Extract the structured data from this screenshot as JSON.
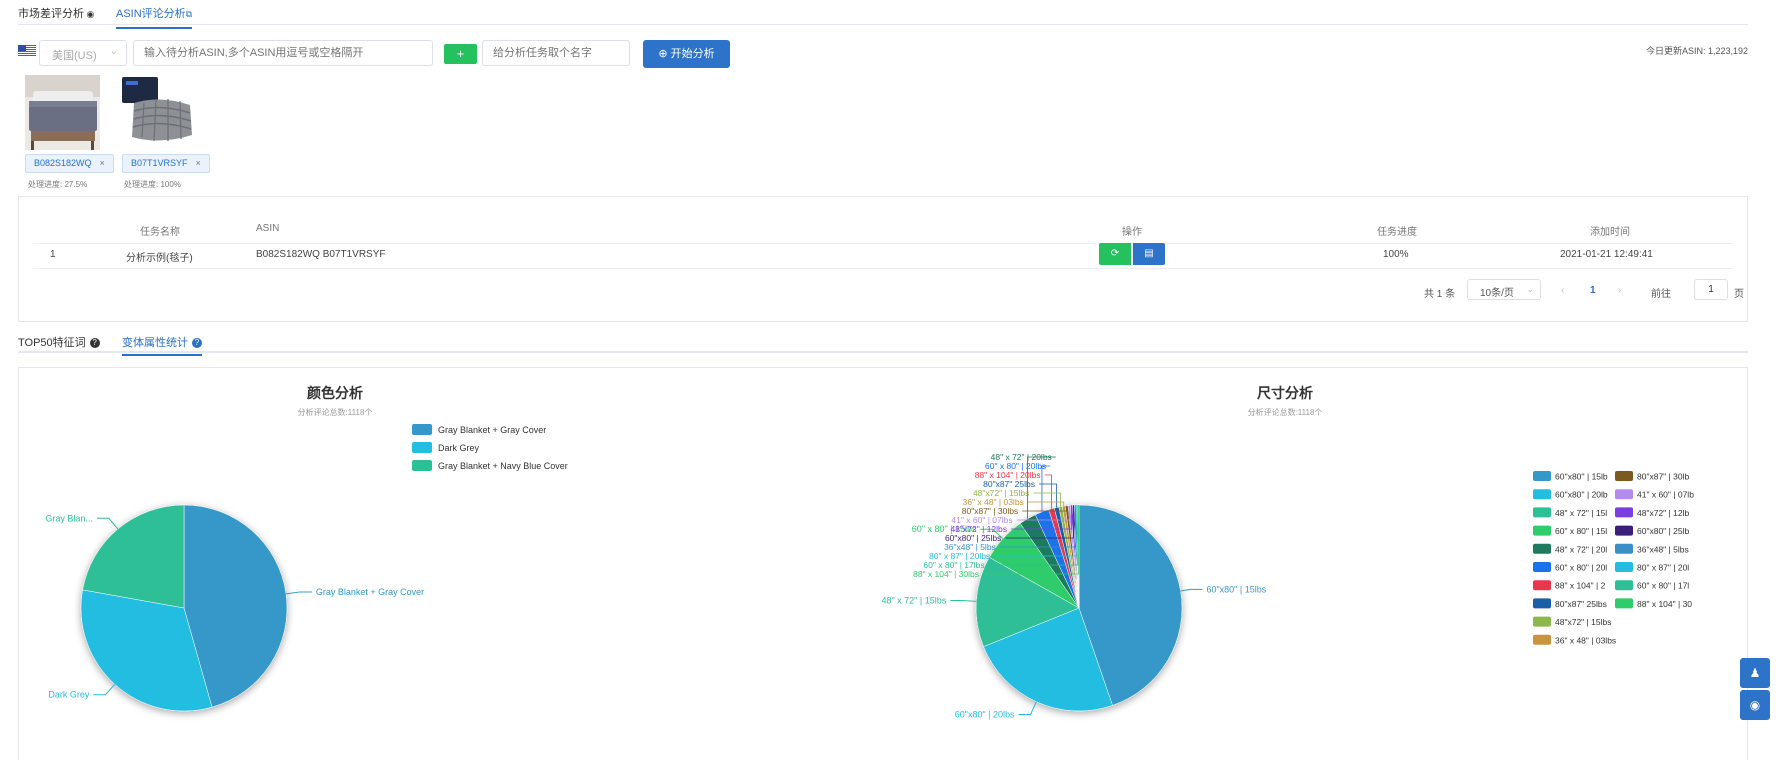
{
  "nav": {
    "tab_market": "市场差评分析",
    "tab_asin": "ASIN评论分析"
  },
  "toolbar": {
    "marketplace": "美国(US)",
    "asin_placeholder": "输入待分析ASIN,多个ASIN用逗号或空格隔开",
    "plus_label": "+",
    "name_placeholder": "给分析任务取个名字",
    "start_label": "开始分析",
    "today_updated": "今日更新ASIN: 1,223,192"
  },
  "asins": [
    {
      "code": "B082S182WQ",
      "progress": "处理进度:   27.5%"
    },
    {
      "code": "B07T1VRSYF",
      "progress": "处理进度:   100%"
    }
  ],
  "table": {
    "headers": {
      "name": "任务名称",
      "asin": "ASIN",
      "op": "操作",
      "progress": "任务进度",
      "time": "添加时间"
    },
    "rows": [
      {
        "index": "1",
        "name": "分析示例(毯子)",
        "asin": "B082S182WQ B07T1VRSYF",
        "progress": "100%",
        "time": "2021-01-21 12:49:41"
      }
    ]
  },
  "pagination": {
    "total": "共 1 条",
    "page_size": "10条/页",
    "current": "1",
    "goto_label": "前往",
    "goto_value": "1",
    "page_unit": "页"
  },
  "subtabs": {
    "top50": "TOP50特征词",
    "variant": "变体属性统计"
  },
  "colors": {
    "accent": "#2b6fc7",
    "green": "#25c15f"
  },
  "chart_data": [
    {
      "type": "pie",
      "title": "颜色分析",
      "subtitle": "分析评论总数:1118个",
      "legend_position": "right",
      "slices": [
        {
          "label": "Gray Blanket + Gray Cover",
          "value": 510,
          "color": "#3498c8",
          "callout": "Gray Blanket + Gray Cover"
        },
        {
          "label": "Dark Grey",
          "value": 360,
          "color": "#23bde0",
          "callout": "Dark Grey"
        },
        {
          "label": "Gray Blanket + Navy Blue Cover",
          "value": 248,
          "color": "#2dbf96",
          "callout": "Gray Blan..."
        }
      ]
    },
    {
      "type": "pie",
      "title": "尺寸分析",
      "subtitle": "分析评论总数:1118个",
      "legend_position": "right",
      "slices": [
        {
          "label": "60\"x80\" | 15lbs",
          "value": 500,
          "color": "#3498c8",
          "callout": "60\"x80\" | 15lbs",
          "legend": "60''x80'' | 15lb"
        },
        {
          "label": "60\"x80\" | 20lbs",
          "value": 270,
          "color": "#23bde0",
          "callout": "60\"x80\" | 20lbs",
          "legend": "60''x80'' | 20lb"
        },
        {
          "label": "48\" x 72\" | 15lbs",
          "value": 160,
          "color": "#2dbf96",
          "callout": "48\" x 72\" | 15lbs",
          "legend": "48\" x 72\" | 15l"
        },
        {
          "label": "60\" x 80\" | 15lbs",
          "value": 80,
          "color": "#2ecc6a",
          "callout": "60\" x 80\" | 15lbs",
          "legend": "60\" x 80\" | 15l"
        },
        {
          "label": "48\" x 72\" | 20lbs",
          "value": 30,
          "color": "#1f7a5e",
          "callout": "48\" x 72\" | 20lbs",
          "legend": "48\" x 72\" | 20l"
        },
        {
          "label": "60\" x 80\" | 20lbs",
          "value": 25,
          "color": "#1a73e8",
          "callout": "60\" x 80\" | 20lbs",
          "legend": "60\" x 80\" | 20l"
        },
        {
          "label": "88\" x 104\" | 20lbs",
          "value": 10,
          "color": "#e8384f",
          "callout": "88\" x 104\" | 20lbs",
          "legend": "88\" x 104\" | 2"
        },
        {
          "label": "80\"x87\" 25lbs",
          "value": 8,
          "color": "#1a5fa8",
          "callout": "80\"x87\" 25lbs",
          "legend": "80\"x87\" 25lbs"
        },
        {
          "label": "48\"x72\" | 15lbs",
          "value": 6,
          "color": "#8db84a",
          "callout": "48\"x72\" | 15lbs",
          "legend": "48\"x72\" | 15lbs"
        },
        {
          "label": "36\" x 48\" | 03lbs",
          "value": 5,
          "color": "#c9943a",
          "callout": "36\" x 48\" | 03lbs",
          "legend": "36\" x 48\" | 03lbs"
        },
        {
          "label": "80\"x87\" | 30lbs",
          "value": 5,
          "color": "#7a5a1e",
          "callout": "80\"x87\" | 30lbs",
          "legend": "80\"x87\" | 30lb"
        },
        {
          "label": "41\" x 60\" | 07lbs",
          "value": 4,
          "color": "#b48cf0",
          "callout": "41\" x 60\" | 07lbs",
          "legend": "41\" x 60\" | 07lb"
        },
        {
          "label": "48\"x72\" | 12lbs",
          "value": 4,
          "color": "#7b3fe0",
          "callout": "48\"x72\" | 12lbs",
          "legend": "48\"x72\" | 12lb"
        },
        {
          "label": "60\"x80\" | 25lbs",
          "value": 3,
          "color": "#3a1f7a",
          "callout": "60\"x80\" | 25lbs",
          "legend": "60\"x80\" | 25lb"
        },
        {
          "label": "36\"x48\" | 5lbs",
          "value": 3,
          "color": "#3a8fc7",
          "callout": "36\"x48\" | 5lbs",
          "legend": "36\"x48\" | 5lbs"
        },
        {
          "label": "80\" x 87\" | 20lbs",
          "value": 2,
          "color": "#23bde0",
          "callout": "80\" x 87\" | 20lbs",
          "legend": "80\" x 87\" | 20l"
        },
        {
          "label": "60\" x 80\" | 17lbs",
          "value": 2,
          "color": "#2dbf96",
          "callout": "60\" x 80\" | 17lbs",
          "legend": "60\" x 80\" | 17l"
        },
        {
          "label": "88\" x 104\" | 30lbs",
          "value": 1,
          "color": "#2ecc6a",
          "callout": "88\" x 104\" | 30lbs",
          "legend": "88\" x 104\" | 30"
        }
      ]
    }
  ]
}
